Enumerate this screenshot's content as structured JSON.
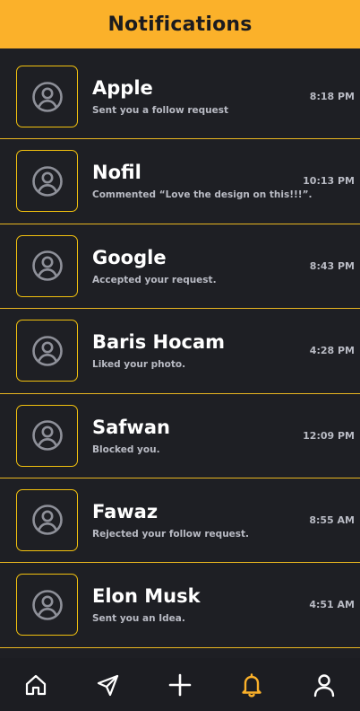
{
  "header": {
    "title": "Notifications"
  },
  "notifications": [
    {
      "name": "Apple",
      "message": "Sent you a follow request",
      "time": "8:18 PM"
    },
    {
      "name": "Nofil",
      "message": "Commented “Love the design on this!!!”.",
      "time": "10:13 PM"
    },
    {
      "name": "Google",
      "message": "Accepted your request.",
      "time": "8:43 PM"
    },
    {
      "name": "Baris Hocam",
      "message": "Liked your photo.",
      "time": "4:28 PM"
    },
    {
      "name": "Safwan",
      "message": "Blocked you.",
      "time": "12:09 PM"
    },
    {
      "name": "Fawaz",
      "message": "Rejected your follow request.",
      "time": "8:55 AM"
    },
    {
      "name": "Elon Musk",
      "message": "Sent you an Idea.",
      "time": "4:51 AM"
    }
  ],
  "nav": {
    "items": [
      {
        "icon": "home-icon",
        "active": false
      },
      {
        "icon": "send-icon",
        "active": false
      },
      {
        "icon": "plus-icon",
        "active": false
      },
      {
        "icon": "bell-icon",
        "active": true
      },
      {
        "icon": "user-icon",
        "active": false
      }
    ]
  },
  "colors": {
    "accent": "#fbb12a",
    "background": "#1e1f24",
    "divider": "#e8b520",
    "avatar_border": "#f2c10e",
    "icon_gray": "#8e9099"
  }
}
